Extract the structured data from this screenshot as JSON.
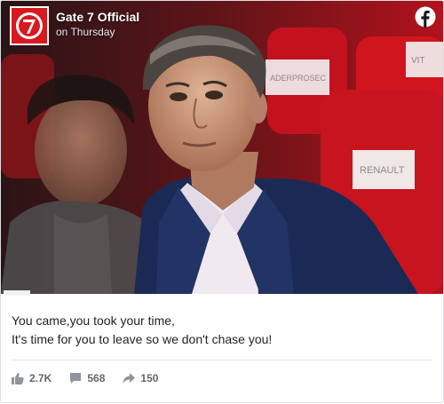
{
  "post": {
    "page_name": "Gate 7 Official",
    "time": "on Thursday",
    "caption_lines": [
      "You came,you took your time,",
      "It's time for you to leave so we don't chase you!"
    ]
  },
  "seat_labels": [
    "ADERPROSEC",
    "RENAULT",
    "VIT"
  ],
  "stats": {
    "likes": "2.7K",
    "comments": "568",
    "shares": "150"
  },
  "icons": {
    "avatar": "gate7-logo-icon",
    "platform": "facebook-icon",
    "likes": "thumbs-up-icon",
    "comments": "comment-icon",
    "shares": "share-arrow-icon"
  },
  "colors": {
    "facebook_white": "#ffffff",
    "logo_red": "#d71920",
    "suit_navy": "#1b2a55",
    "seat_red": "#c3121e",
    "text": "#1d2129",
    "muted": "#616770"
  }
}
